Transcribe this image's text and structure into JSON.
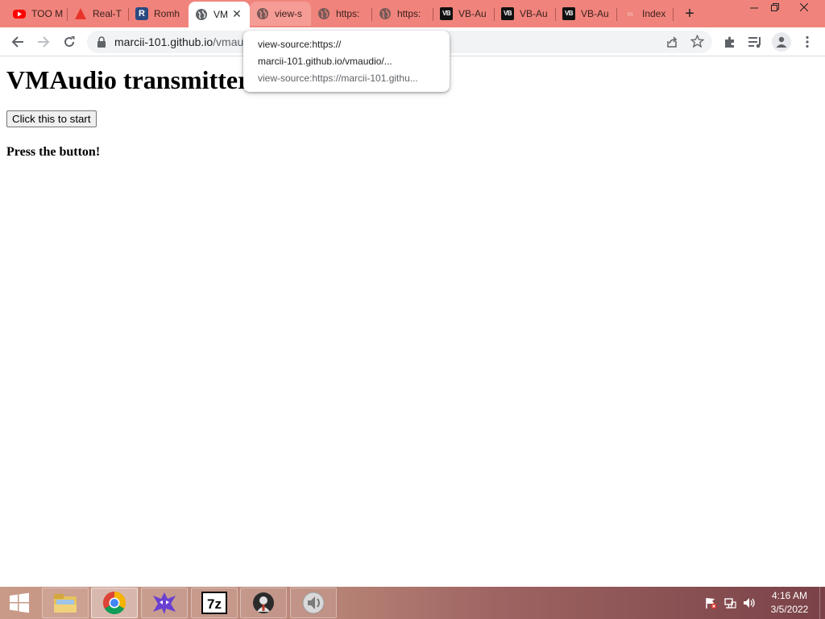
{
  "browser": {
    "tabs": [
      {
        "title": "TOO M",
        "favicon": "youtube-icon"
      },
      {
        "title": "Real-T",
        "favicon": "warning-triangle-icon"
      },
      {
        "title": "Romh",
        "favicon": "r-logo-icon"
      },
      {
        "title": "VM",
        "favicon": "globe-icon",
        "active": true
      },
      {
        "title": "view-s",
        "favicon": "globe-icon"
      },
      {
        "title": "https:",
        "favicon": "globe-icon"
      },
      {
        "title": "https:",
        "favicon": "globe-icon"
      },
      {
        "title": "VB-Au",
        "favicon": "vb-audio-icon"
      },
      {
        "title": "VB-Au",
        "favicon": "vb-audio-icon"
      },
      {
        "title": "VB-Au",
        "favicon": "vb-audio-icon"
      },
      {
        "title": "Index",
        "favicon": "dim-logo-icon"
      }
    ],
    "tabstrip_color": "#f0847c",
    "address": {
      "host": "marcii-101.github.io",
      "path": "/vmau"
    },
    "tooltip": {
      "line1": "view-source:https://",
      "line2": "marcii-101.github.io/vmaudio/...",
      "line3": "view-source:https://marcii-101.githu..."
    }
  },
  "page": {
    "heading": "VMAudio transmitter",
    "start_button": "Click this to start",
    "status": "Press the button!"
  },
  "taskbar": {
    "pinned": [
      "windows-explorer-icon",
      "chrome-icon",
      "app-icon",
      "7zip-icon",
      "app-icon",
      "speaker-app-icon"
    ],
    "clock_time": "4:16 AM",
    "clock_date": "3/5/2022"
  }
}
